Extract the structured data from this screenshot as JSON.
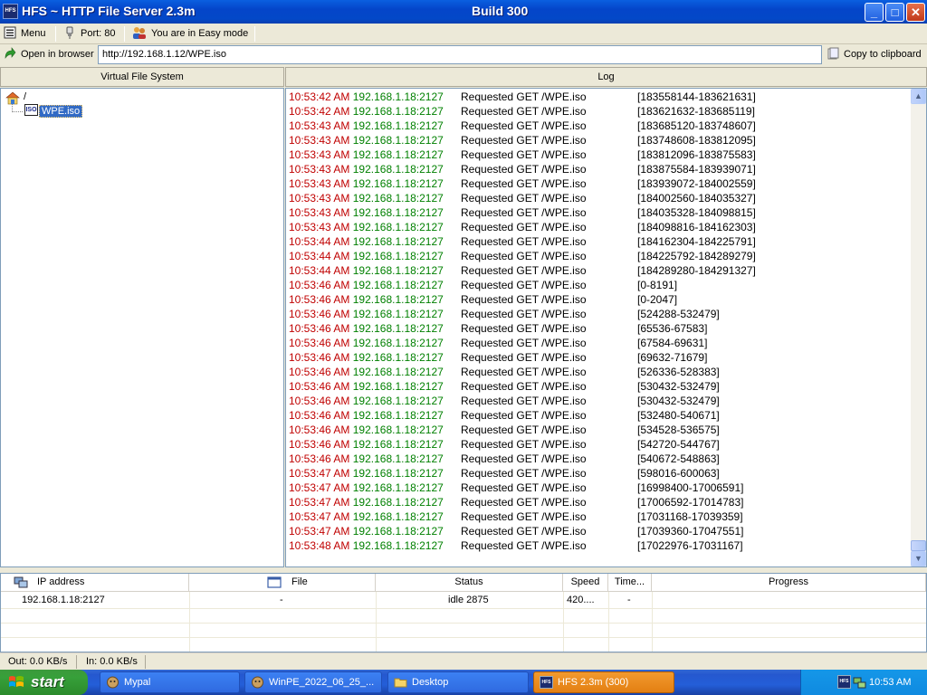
{
  "window": {
    "title": "HFS ~ HTTP File Server 2.3m",
    "build": "Build 300",
    "app_icon_text": "HFS",
    "buttons": {
      "minimize": "_",
      "maximize": "□",
      "close": "✕"
    }
  },
  "toolbar": {
    "menu": "Menu",
    "port": "Port: 80",
    "mode": "You are in Easy mode",
    "open_in_browser": "Open in browser",
    "url": "http://192.168.1.12/WPE.iso",
    "copy_to_clipboard": "Copy to clipboard"
  },
  "vfs": {
    "header": "Virtual File System",
    "root": "/",
    "file": "WPE.iso",
    "file_icon_text": "ISO"
  },
  "log": {
    "header": "Log",
    "entries": [
      {
        "time": "10:53:42 AM",
        "ip": "192.168.1.18:2127",
        "request": "Requested GET /WPE.iso",
        "range": "[183558144-183621631]"
      },
      {
        "time": "10:53:42 AM",
        "ip": "192.168.1.18:2127",
        "request": "Requested GET /WPE.iso",
        "range": "[183621632-183685119]"
      },
      {
        "time": "10:53:43 AM",
        "ip": "192.168.1.18:2127",
        "request": "Requested GET /WPE.iso",
        "range": "[183685120-183748607]"
      },
      {
        "time": "10:53:43 AM",
        "ip": "192.168.1.18:2127",
        "request": "Requested GET /WPE.iso",
        "range": "[183748608-183812095]"
      },
      {
        "time": "10:53:43 AM",
        "ip": "192.168.1.18:2127",
        "request": "Requested GET /WPE.iso",
        "range": "[183812096-183875583]"
      },
      {
        "time": "10:53:43 AM",
        "ip": "192.168.1.18:2127",
        "request": "Requested GET /WPE.iso",
        "range": "[183875584-183939071]"
      },
      {
        "time": "10:53:43 AM",
        "ip": "192.168.1.18:2127",
        "request": "Requested GET /WPE.iso",
        "range": "[183939072-184002559]"
      },
      {
        "time": "10:53:43 AM",
        "ip": "192.168.1.18:2127",
        "request": "Requested GET /WPE.iso",
        "range": "[184002560-184035327]"
      },
      {
        "time": "10:53:43 AM",
        "ip": "192.168.1.18:2127",
        "request": "Requested GET /WPE.iso",
        "range": "[184035328-184098815]"
      },
      {
        "time": "10:53:43 AM",
        "ip": "192.168.1.18:2127",
        "request": "Requested GET /WPE.iso",
        "range": "[184098816-184162303]"
      },
      {
        "time": "10:53:44 AM",
        "ip": "192.168.1.18:2127",
        "request": "Requested GET /WPE.iso",
        "range": "[184162304-184225791]"
      },
      {
        "time": "10:53:44 AM",
        "ip": "192.168.1.18:2127",
        "request": "Requested GET /WPE.iso",
        "range": "[184225792-184289279]"
      },
      {
        "time": "10:53:44 AM",
        "ip": "192.168.1.18:2127",
        "request": "Requested GET /WPE.iso",
        "range": "[184289280-184291327]"
      },
      {
        "time": "10:53:46 AM",
        "ip": "192.168.1.18:2127",
        "request": "Requested GET /WPE.iso",
        "range": "[0-8191]"
      },
      {
        "time": "10:53:46 AM",
        "ip": "192.168.1.18:2127",
        "request": "Requested GET /WPE.iso",
        "range": "[0-2047]"
      },
      {
        "time": "10:53:46 AM",
        "ip": "192.168.1.18:2127",
        "request": "Requested GET /WPE.iso",
        "range": "[524288-532479]"
      },
      {
        "time": "10:53:46 AM",
        "ip": "192.168.1.18:2127",
        "request": "Requested GET /WPE.iso",
        "range": "[65536-67583]"
      },
      {
        "time": "10:53:46 AM",
        "ip": "192.168.1.18:2127",
        "request": "Requested GET /WPE.iso",
        "range": "[67584-69631]"
      },
      {
        "time": "10:53:46 AM",
        "ip": "192.168.1.18:2127",
        "request": "Requested GET /WPE.iso",
        "range": "[69632-71679]"
      },
      {
        "time": "10:53:46 AM",
        "ip": "192.168.1.18:2127",
        "request": "Requested GET /WPE.iso",
        "range": "[526336-528383]"
      },
      {
        "time": "10:53:46 AM",
        "ip": "192.168.1.18:2127",
        "request": "Requested GET /WPE.iso",
        "range": "[530432-532479]"
      },
      {
        "time": "10:53:46 AM",
        "ip": "192.168.1.18:2127",
        "request": "Requested GET /WPE.iso",
        "range": "[530432-532479]"
      },
      {
        "time": "10:53:46 AM",
        "ip": "192.168.1.18:2127",
        "request": "Requested GET /WPE.iso",
        "range": "[532480-540671]"
      },
      {
        "time": "10:53:46 AM",
        "ip": "192.168.1.18:2127",
        "request": "Requested GET /WPE.iso",
        "range": "[534528-536575]"
      },
      {
        "time": "10:53:46 AM",
        "ip": "192.168.1.18:2127",
        "request": "Requested GET /WPE.iso",
        "range": "[542720-544767]"
      },
      {
        "time": "10:53:46 AM",
        "ip": "192.168.1.18:2127",
        "request": "Requested GET /WPE.iso",
        "range": "[540672-548863]"
      },
      {
        "time": "10:53:47 AM",
        "ip": "192.168.1.18:2127",
        "request": "Requested GET /WPE.iso",
        "range": "[598016-600063]"
      },
      {
        "time": "10:53:47 AM",
        "ip": "192.168.1.18:2127",
        "request": "Requested GET /WPE.iso",
        "range": "[16998400-17006591]"
      },
      {
        "time": "10:53:47 AM",
        "ip": "192.168.1.18:2127",
        "request": "Requested GET /WPE.iso",
        "range": "[17006592-17014783]"
      },
      {
        "time": "10:53:47 AM",
        "ip": "192.168.1.18:2127",
        "request": "Requested GET /WPE.iso",
        "range": "[17031168-17039359]"
      },
      {
        "time": "10:53:47 AM",
        "ip": "192.168.1.18:2127",
        "request": "Requested GET /WPE.iso",
        "range": "[17039360-17047551]"
      },
      {
        "time": "10:53:48 AM",
        "ip": "192.168.1.18:2127",
        "request": "Requested GET /WPE.iso",
        "range": "[17022976-17031167]"
      }
    ]
  },
  "connections": {
    "columns": {
      "ip": "IP address",
      "file": "File",
      "status": "Status",
      "speed": "Speed",
      "time": "Time...",
      "progress": "Progress"
    },
    "rows": [
      {
        "ip": "192.168.1.18:2127",
        "file": "-",
        "status": "idle 2875",
        "speed": "420....",
        "time": "-",
        "progress": ""
      }
    ]
  },
  "status_bar": {
    "out": "Out: 0.0 KB/s",
    "in": "In: 0.0 KB/s"
  },
  "taskbar": {
    "start": "start",
    "tasks": [
      {
        "label": "Mypal",
        "active": false
      },
      {
        "label": "WinPE_2022_06_25_...",
        "active": false
      },
      {
        "label": "Desktop",
        "active": false
      },
      {
        "label": "HFS 2.3m (300)",
        "active": true
      }
    ],
    "tray_icon_text": "HFS",
    "clock": "10:53 AM"
  },
  "colors": {
    "log_time": "#c00000",
    "log_ip": "#008000",
    "titlebar": "#0348c8",
    "taskbar": "#245ed8",
    "start": "#37a03a",
    "active_task": "#e37f12"
  }
}
